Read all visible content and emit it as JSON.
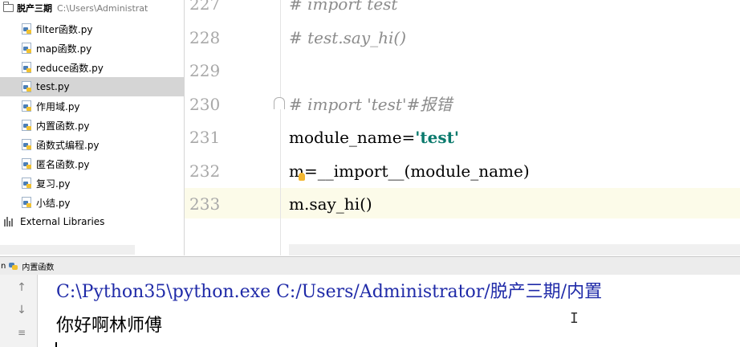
{
  "project": {
    "name": "脱产三期",
    "path": "C:\\Users\\Administrat",
    "files": [
      {
        "name": "filter函数.py"
      },
      {
        "name": "map函数.py"
      },
      {
        "name": "reduce函数.py"
      },
      {
        "name": "test.py",
        "selected": true
      },
      {
        "name": "作用域.py"
      },
      {
        "name": "内置函数.py"
      },
      {
        "name": "函数式编程.py"
      },
      {
        "name": "匿名函数.py"
      },
      {
        "name": "复习.py"
      },
      {
        "name": "小结.py"
      }
    ],
    "external_libraries": "External Libraries"
  },
  "editor": {
    "lines": [
      {
        "num": "227",
        "parts": [
          {
            "text": "# import test",
            "cls": "comment"
          }
        ]
      },
      {
        "num": "228",
        "parts": [
          {
            "text": "# test.say_hi()",
            "cls": "comment"
          }
        ]
      },
      {
        "num": "229",
        "parts": []
      },
      {
        "num": "230",
        "parts": [
          {
            "text": "# import 'test'#报错",
            "cls": "comment"
          }
        ]
      },
      {
        "num": "231",
        "parts": [
          {
            "text": "module_name=",
            "cls": ""
          },
          {
            "text": "'test'",
            "cls": "string"
          }
        ]
      },
      {
        "num": "232",
        "parts": [
          {
            "text": "m=__import__(module_name)",
            "cls": ""
          }
        ]
      },
      {
        "num": "233",
        "parts": [
          {
            "text": "m.say_hi()",
            "cls": ""
          }
        ]
      }
    ],
    "current_line": "233"
  },
  "run": {
    "label": "n",
    "tab_name": "内置函数",
    "console_command": "C:\\Python35\\python.exe C:/Users/Administrator/脱产三期/内置",
    "console_output": "你好啊林师傅"
  },
  "colors": {
    "comment": "#8c8c8c",
    "string": "#0b7a6d",
    "current_line_bg": "#fcfbe9",
    "selected_file_bg": "#d5d5d5",
    "console_command": "#1f2aa8"
  }
}
